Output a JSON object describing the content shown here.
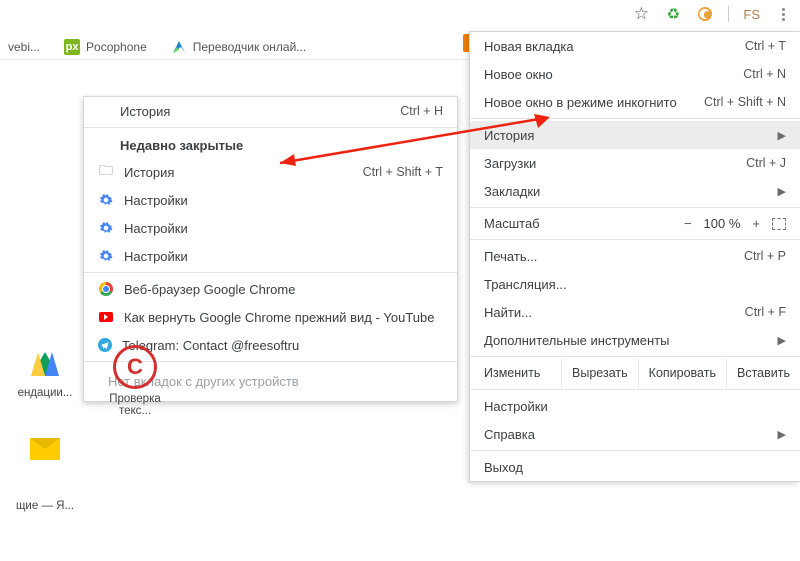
{
  "toolbar": {
    "fs_label": "FS"
  },
  "bookmarks": {
    "b1": "vebi...",
    "b2": "Pocophone",
    "b3": "Переводчик онлай..."
  },
  "main_menu": {
    "new_tab": {
      "label": "Новая вкладка",
      "shortcut": "Ctrl + T"
    },
    "new_window": {
      "label": "Новое окно",
      "shortcut": "Ctrl + N"
    },
    "incognito": {
      "label": "Новое окно в режиме инкогнито",
      "shortcut": "Ctrl + Shift + N"
    },
    "history": {
      "label": "История"
    },
    "downloads": {
      "label": "Загрузки",
      "shortcut": "Ctrl + J"
    },
    "bookmarks": {
      "label": "Закладки"
    },
    "zoom": {
      "label": "Масштаб",
      "minus": "−",
      "pct": "100 %",
      "plus": "+"
    },
    "print": {
      "label": "Печать...",
      "shortcut": "Ctrl + P"
    },
    "cast": {
      "label": "Трансляция..."
    },
    "find": {
      "label": "Найти...",
      "shortcut": "Ctrl + F"
    },
    "more_tools": {
      "label": "Дополнительные инструменты"
    },
    "edit": {
      "label": "Изменить",
      "cut": "Вырезать",
      "copy": "Копировать",
      "paste": "Вставить"
    },
    "settings": {
      "label": "Настройки"
    },
    "help": {
      "label": "Справка"
    },
    "exit": {
      "label": "Выход"
    }
  },
  "sub_menu": {
    "title": {
      "label": "История",
      "shortcut": "Ctrl + H"
    },
    "recent_header": "Недавно закрытые",
    "items": [
      {
        "label": "История",
        "shortcut": "Ctrl + Shift + T"
      },
      {
        "label": "Настройки"
      },
      {
        "label": "Настройки"
      },
      {
        "label": "Настройки"
      }
    ],
    "hist2": [
      {
        "label": "Веб-браузер Google Chrome"
      },
      {
        "label": "Как вернуть Google Chrome прежний вид - YouTube"
      },
      {
        "label": "Telegram: Contact @freesoftru"
      }
    ],
    "no_tabs": "Нет вкладок с других устройств"
  },
  "desktop": {
    "d1": "ендации...",
    "d2": "Проверка текс...",
    "d3": "щие — Я..."
  }
}
